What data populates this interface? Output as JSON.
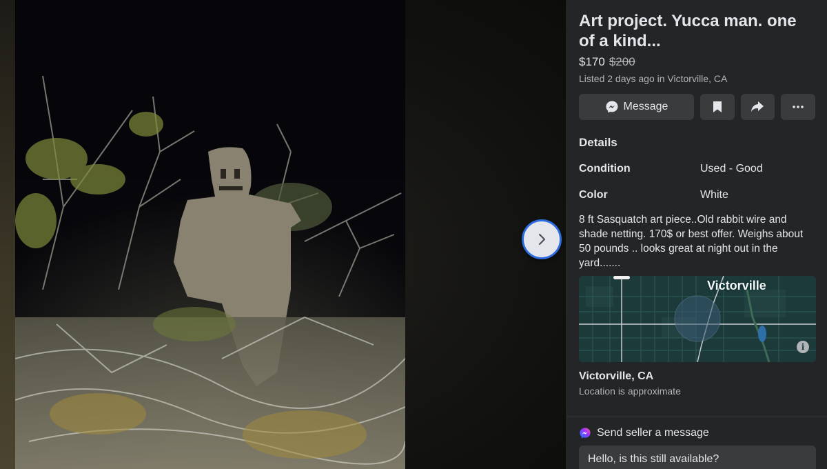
{
  "listing": {
    "title": "Art project. Yucca man. one of a kind...",
    "price": "$170",
    "original_price": "$200",
    "listed": "Listed 2 days ago in Victorville, CA"
  },
  "actions": {
    "message_label": "Message",
    "icons": [
      "messenger-icon",
      "bookmark-icon",
      "share-icon",
      "more-icon"
    ]
  },
  "details": {
    "heading": "Details",
    "rows": [
      {
        "key": "Condition",
        "value": "Used - Good"
      },
      {
        "key": "Color",
        "value": "White"
      }
    ],
    "description": "8 ft Sasquatch art piece..Old  rabbit wire and shade netting. 170$ or best offer. Weighs about 50 pounds .. looks great at night out in the yard......."
  },
  "map": {
    "label": "Victorville",
    "info_icon": "i"
  },
  "location": {
    "name": "Victorville, CA",
    "note": "Location is approximate"
  },
  "send": {
    "label": "Send seller a message",
    "input_value": "Hello, is this still available?"
  },
  "viewer": {
    "next_icon": "chevron-right-icon"
  },
  "colors": {
    "panel_bg": "#242526",
    "button_bg": "#3a3b3c",
    "text_primary": "#e4e6eb",
    "text_secondary": "#b0b3b8",
    "focus_ring": "#2d6cdf",
    "map_bg": "#1d3a3a"
  }
}
